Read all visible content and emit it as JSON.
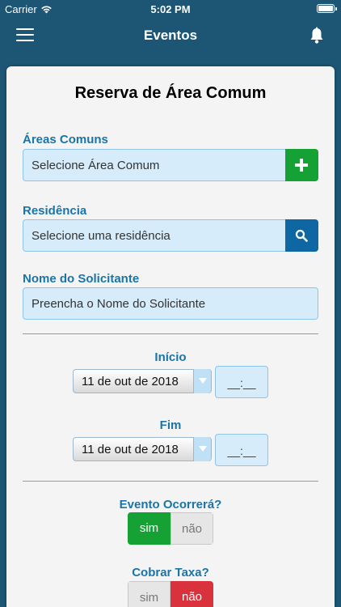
{
  "status_bar": {
    "carrier": "Carrier",
    "time": "5:02 PM"
  },
  "nav": {
    "title": "Eventos",
    "menu_icon": "hamburger-menu-icon",
    "bell_icon": "bell-icon"
  },
  "form": {
    "title": "Reserva de Área Comum",
    "areas": {
      "label": "Áreas Comuns",
      "placeholder": "Selecione Área Comum",
      "add_icon": "plus-icon"
    },
    "residencia": {
      "label": "Residência",
      "placeholder": "Selecione uma residência",
      "search_icon": "search-icon"
    },
    "solicitante": {
      "label": "Nome do Solicitante",
      "placeholder": "Preencha o Nome do Solicitante"
    },
    "inicio": {
      "label": "Início",
      "date": "11 de out de 2018",
      "time": "__:__"
    },
    "fim": {
      "label": "Fim",
      "date": "11 de out de 2018",
      "time": "__:__"
    },
    "evento_ocorrera": {
      "label": "Evento Ocorrerá?",
      "yes": "sim",
      "no": "não",
      "selected": "sim"
    },
    "cobrar_taxa": {
      "label": "Cobrar Taxa?",
      "yes": "sim",
      "no": "não",
      "selected": "não"
    }
  },
  "colors": {
    "header": "#1d5675",
    "accent_label": "#1a74a7",
    "input_bg": "#d6ecfa",
    "green": "#16a134",
    "blue_button": "#0e67a3",
    "red": "#d9323d"
  }
}
